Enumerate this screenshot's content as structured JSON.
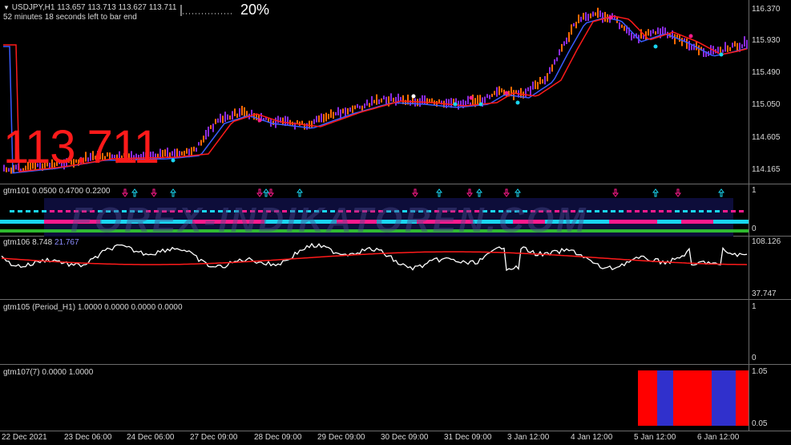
{
  "header": {
    "symbol_line": "USDJPY,H1  113.657 113.713 113.627 113.711",
    "bar_timer": "52 minutes 18 seconds left to bar end",
    "progress_text": "20%"
  },
  "main": {
    "big_price": "113.711",
    "price_scale": [
      "116.370",
      "115.930",
      "115.490",
      "115.050",
      "114.605",
      "114.165"
    ]
  },
  "indicators": {
    "gtm101": {
      "label": "gtm101 0.0500 0.4700 0.2200",
      "scale_top": "1",
      "scale_bottom": "0"
    },
    "gtm106": {
      "label_prefix": "gtm106 8.748",
      "label_value": "21.767",
      "scale_top": "108.126",
      "scale_bottom": "37.747"
    },
    "gtm105": {
      "label": "gtm105 (Period_H1) 1.0000 0.0000 0.0000 0.0000",
      "scale_top": "1",
      "scale_bottom": "0"
    },
    "gtm107": {
      "label": "gtm107(7) 0.0000 1.0000",
      "scale_top": "1.05",
      "scale_bottom": "0.05"
    }
  },
  "watermark": "FOREX-INDIKATOREN.COM",
  "time_axis": [
    "22 Dec 2021",
    "23 Dec 06:00",
    "24 Dec 06:00",
    "27 Dec 09:00",
    "28 Dec 09:00",
    "29 Dec 09:00",
    "30 Dec 09:00",
    "31 Dec 09:00",
    "3 Jan 12:00",
    "4 Jan 12:00",
    "5 Jan 12:00",
    "6 Jan 12:00"
  ],
  "colors": {
    "bull_candle": "#8a2be2",
    "bear_candle": "#ff6a00",
    "ma_blue": "#3a5cff",
    "ma_red": "#ff1a1a",
    "cyan": "#19d5f0",
    "magenta": "#ff1a8c",
    "green_dots": "#33cc33",
    "oscillator": "#ffffff",
    "bar_red": "#ff0000",
    "bar_blue": "#3030cc"
  },
  "icons": [
    "dropdown-triangle-icon",
    "up-arrow-icon",
    "down-arrow-icon"
  ]
}
